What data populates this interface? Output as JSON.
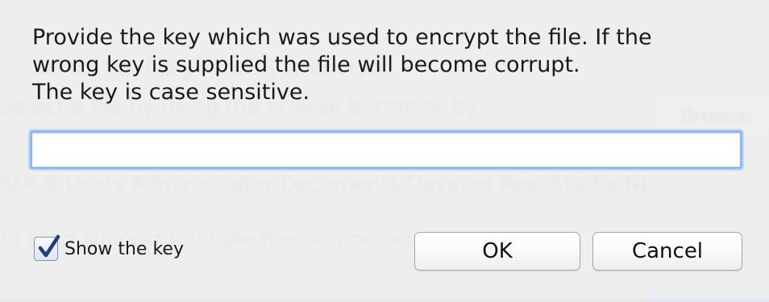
{
  "dialog": {
    "message_lines": [
      "Provide the key which was used to encrypt the file. If the",
      "wrong key is supplied the file will become corrupt.",
      "The key is case sensitive."
    ],
    "key_input": {
      "value": "",
      "placeholder": ""
    },
    "show_key": {
      "label": "Show the key",
      "checked": true
    },
    "ok_label": "OK",
    "cancel_label": "Cancel",
    "focus_color": "#8fb8ec"
  }
}
